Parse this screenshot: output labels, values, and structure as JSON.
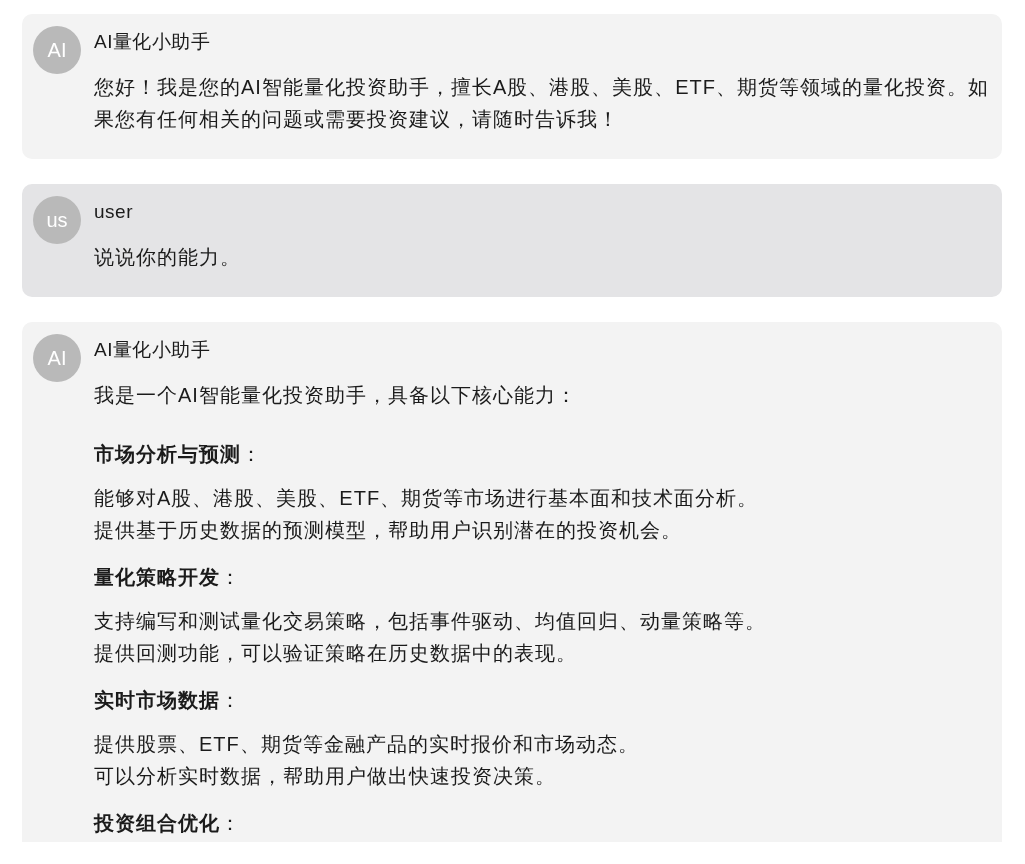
{
  "messages": [
    {
      "kind": "assistant",
      "avatar": "AI",
      "sender": "AI量化小助手",
      "content": [
        {
          "kind": "paragraph",
          "text": "您好！我是您的AI智能量化投资助手，擅长A股、港股、美股、ETF、期货等领域的量化投资。如果您有任何相关的问题或需要投资建议，请随时告诉我！"
        }
      ]
    },
    {
      "kind": "user",
      "avatar": "us",
      "sender": "user",
      "content": [
        {
          "kind": "paragraph",
          "text": "说说你的能力。"
        }
      ]
    },
    {
      "kind": "assistant",
      "avatar": "AI",
      "sender": "AI量化小助手",
      "content": [
        {
          "kind": "paragraph",
          "text": "我是一个AI智能量化投资助手，具备以下核心能力："
        },
        {
          "kind": "heading",
          "text": "**市场分析与预测**："
        },
        {
          "kind": "lines",
          "lines": [
            "能够对A股、港股、美股、ETF、期货等市场进行基本面和技术面分析。",
            "提供基于历史数据的预测模型，帮助用户识别潜在的投资机会。"
          ]
        },
        {
          "kind": "heading",
          "text": "**量化策略开发**："
        },
        {
          "kind": "lines",
          "lines": [
            "支持编写和测试量化交易策略，包括事件驱动、均值回归、动量策略等。",
            "提供回测功能，可以验证策略在历史数据中的表现。"
          ]
        },
        {
          "kind": "heading",
          "text": "**实时市场数据**："
        },
        {
          "kind": "lines",
          "lines": [
            "提供股票、ETF、期货等金融产品的实时报价和市场动态。",
            "可以分析实时数据，帮助用户做出快速投资决策。"
          ]
        },
        {
          "kind": "heading",
          "text": "**投资组合优化**："
        }
      ]
    }
  ]
}
